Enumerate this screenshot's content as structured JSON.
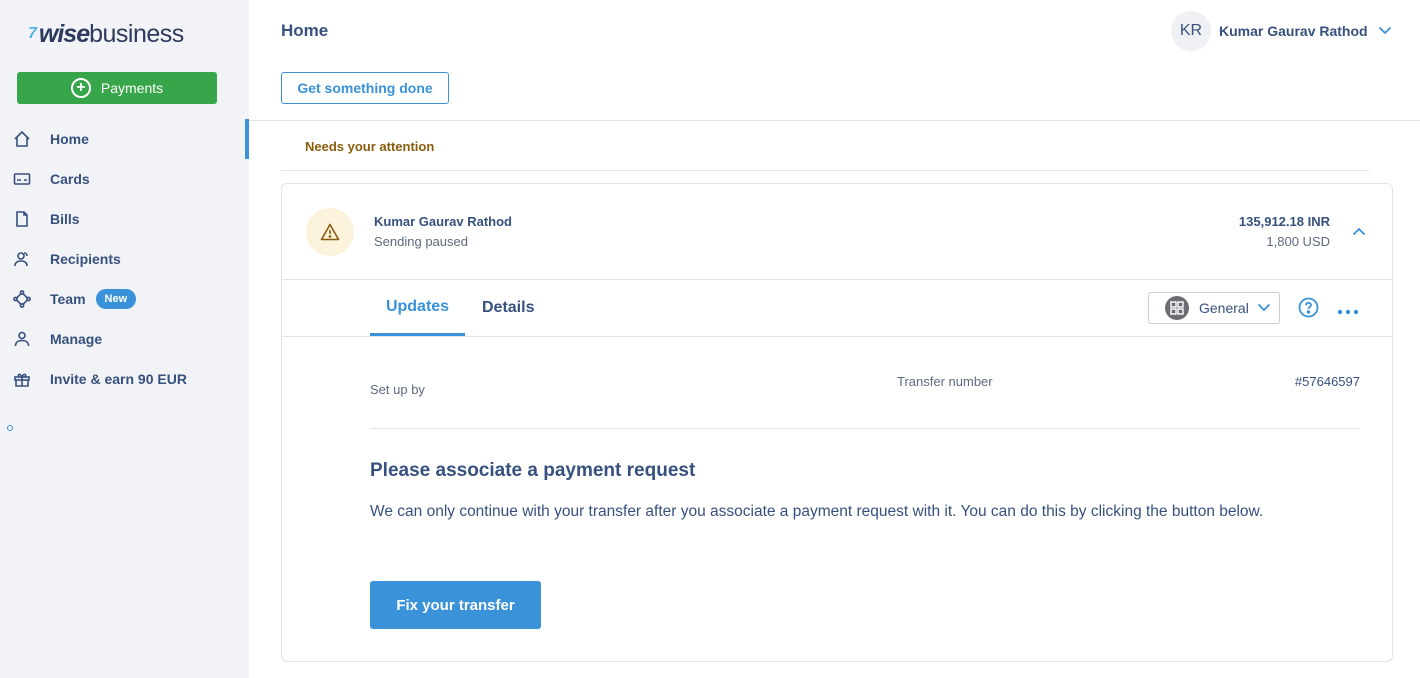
{
  "brand": {
    "flag": "7",
    "wise": "wise",
    "business": "business"
  },
  "sidebar": {
    "payments_label": "Payments",
    "items": [
      {
        "label": "Home",
        "icon": "home-icon",
        "active": true
      },
      {
        "label": "Cards",
        "icon": "card-icon"
      },
      {
        "label": "Bills",
        "icon": "document-icon"
      },
      {
        "label": "Recipients",
        "icon": "recipients-icon"
      },
      {
        "label": "Team",
        "icon": "team-icon",
        "badge": "New"
      },
      {
        "label": "Manage",
        "icon": "person-icon"
      },
      {
        "label": "Invite & earn 90 EUR",
        "icon": "gift-icon"
      }
    ]
  },
  "header": {
    "title": "Home",
    "action_label": "Get something done",
    "user": {
      "initials": "KR",
      "name": "Kumar Gaurav Rathod"
    }
  },
  "attention": {
    "heading": "Needs your attention",
    "transfer": {
      "recipient": "Kumar Gaurav Rathod",
      "status": "Sending paused",
      "amount_target": "135,912.18 INR",
      "amount_source": "1,800 USD",
      "tabs": [
        {
          "label": "Updates",
          "active": true
        },
        {
          "label": "Details"
        }
      ],
      "category_select": "General",
      "setup_label": "Set up by",
      "transfer_number_label": "Transfer number",
      "transfer_number": "#57646597",
      "request_title": "Please associate a payment request",
      "request_text": "We can only continue with your transfer after you associate a payment request with it. You can do this by clicking the button below.",
      "fix_label": "Fix your transfer"
    }
  },
  "colors": {
    "accent": "#3a92d8",
    "payments_green": "#37a549",
    "text": "#37517e",
    "attention": "#8a5c0e",
    "warning_bg": "#fcf3dc"
  }
}
